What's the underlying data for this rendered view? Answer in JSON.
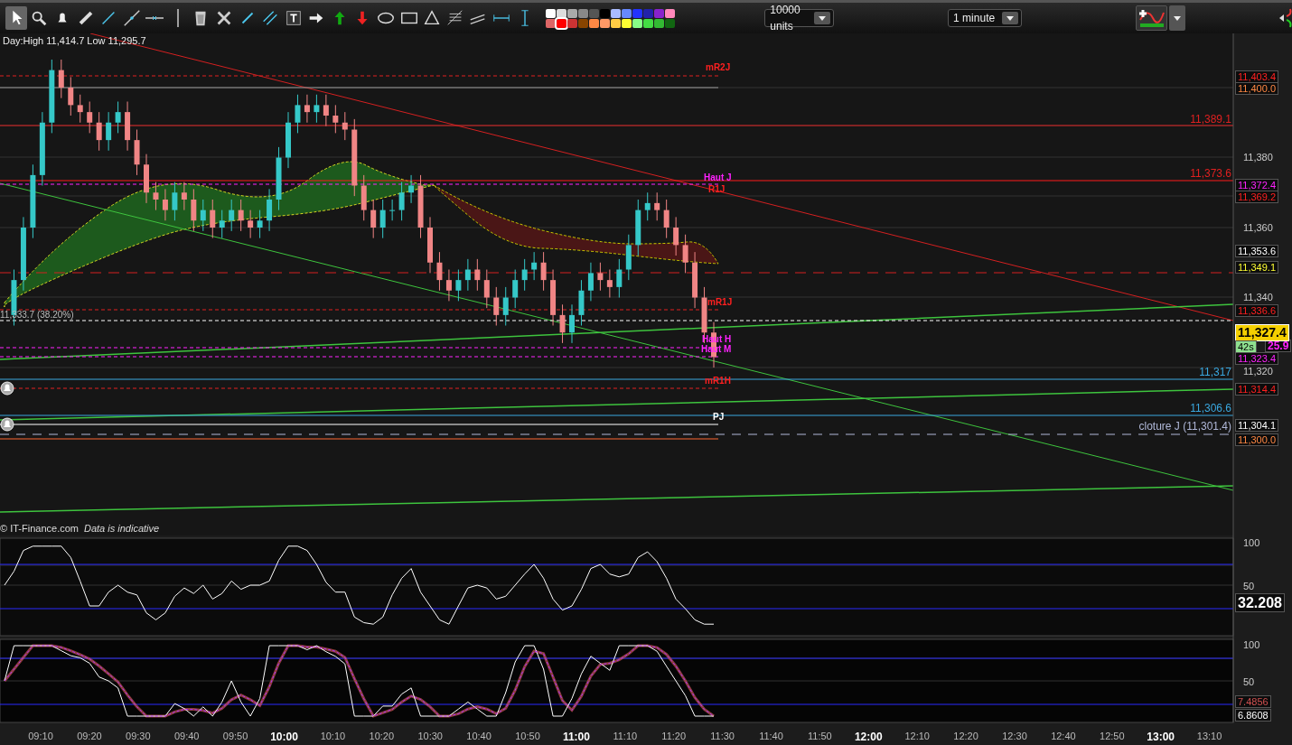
{
  "toolbar": {
    "tools": [
      {
        "selected": true
      },
      {
        "selected": false
      },
      {
        "selected": false
      },
      {
        "selected": false
      },
      {
        "selected": false
      },
      {
        "selected": false
      },
      {
        "selected": false
      },
      {
        "selected": false
      },
      {
        "selected": false
      },
      {
        "selected": false
      },
      {
        "selected": false
      },
      {
        "selected": false
      },
      {
        "selected": false
      },
      {
        "selected": false
      },
      {
        "selected": false
      },
      {
        "selected": false
      },
      {
        "selected": false
      },
      {
        "selected": false
      },
      {
        "selected": false
      },
      {
        "selected": false
      },
      {
        "selected": false
      },
      {
        "selected": false
      },
      {
        "selected": false
      }
    ],
    "swatches": [
      {
        "color": "#ffffff",
        "selected": false
      },
      {
        "color": "#dddddd",
        "selected": false
      },
      {
        "color": "#aaaaaa",
        "selected": false
      },
      {
        "color": "#888888",
        "selected": false
      },
      {
        "color": "#555555",
        "selected": false
      },
      {
        "color": "#000000",
        "selected": false
      },
      {
        "color": "#aabbff",
        "selected": false
      },
      {
        "color": "#6688ff",
        "selected": false
      },
      {
        "color": "#2233ff",
        "selected": false
      },
      {
        "color": "#2222aa",
        "selected": false
      },
      {
        "color": "#8822cc",
        "selected": false
      },
      {
        "color": "#ff88bb",
        "selected": false
      },
      {
        "color": "#dd6666",
        "selected": false
      },
      {
        "color": "#ff0000",
        "selected": true
      },
      {
        "color": "#cc3333",
        "selected": false
      },
      {
        "color": "#884400",
        "selected": false
      },
      {
        "color": "#ff8844",
        "selected": false
      },
      {
        "color": "#ff9966",
        "selected": false
      },
      {
        "color": "#ffcc44",
        "selected": false
      },
      {
        "color": "#ffff33",
        "selected": false
      },
      {
        "color": "#88ff88",
        "selected": false
      },
      {
        "color": "#44dd44",
        "selected": false
      },
      {
        "color": "#33bb33",
        "selected": false
      },
      {
        "color": "#116611",
        "selected": false
      }
    ],
    "quantity_dropdown": {
      "value": "10000 units"
    },
    "interval_dropdown": {
      "value": "1 minute"
    }
  },
  "chart": {
    "header": "Day:High 11,414.7 Low 11,295.7",
    "fib_label": "11,333.7 (38.20%)",
    "level_labels": [
      {
        "text": "mR2J",
        "color": "#ff2020"
      },
      {
        "text": "Haut J",
        "color": "#ff22ff"
      },
      {
        "text": "R1J",
        "color": "#ff2020"
      },
      {
        "text": "mR1J",
        "color": "#ff2020"
      },
      {
        "text": "Haut H",
        "color": "#ff22ff"
      },
      {
        "text": "Haut M",
        "color": "#ff22ff"
      },
      {
        "text": "mR1H",
        "color": "#ff2020"
      },
      {
        "text": "PJ",
        "color": "#ffffff"
      }
    ],
    "line_labels": [
      {
        "text": "11,389.1",
        "kind": "resistance"
      },
      {
        "text": "11,373.6",
        "kind": "resistance"
      },
      {
        "text": "11,317",
        "kind": "pivot"
      },
      {
        "text": "11,306.6",
        "kind": "pivot"
      },
      {
        "text": "cloture J (11,301.4)",
        "kind": "close"
      }
    ],
    "copyright": "© IT-Finance.com",
    "disclaimer": "Data is indicative",
    "price_axis": {
      "ticks": [
        "11,380",
        "11,360",
        "11,340",
        "11,320"
      ],
      "tags": [
        {
          "text": "11,403.4",
          "color": "#ff2020"
        },
        {
          "text": "11,400.0",
          "color": "#ff8844"
        },
        {
          "text": "11,372.4",
          "color": "#ff22ff"
        },
        {
          "text": "11,369.2",
          "color": "#ff2020"
        },
        {
          "text": "11,353.6",
          "color": "#ffffff"
        },
        {
          "text": "11,349.1",
          "color": "#ffff33"
        },
        {
          "text": "11,336.6",
          "color": "#ff2020"
        },
        {
          "text": "25.9",
          "color": "#ff22ff"
        },
        {
          "text": "11,323.4",
          "color": "#ff22ff"
        },
        {
          "text": "11,314.4",
          "color": "#ff2020"
        },
        {
          "text": "11,304.1",
          "color": "#ffffff"
        },
        {
          "text": "11,300.0",
          "color": "#ff8844"
        }
      ],
      "last_price": "11,327.4",
      "countdown": "42s"
    }
  },
  "rsi_panel": {
    "ticks": [
      "100",
      "50"
    ],
    "value": "32.208"
  },
  "stochastic_panel": {
    "ticks": [
      "100",
      "50"
    ],
    "values": [
      {
        "text": "7.4856",
        "color": "#d05050"
      },
      {
        "text": "6.8608",
        "color": "#ffffff"
      }
    ]
  },
  "time_axis": [
    {
      "label": "09:10",
      "major": false
    },
    {
      "label": "09:20",
      "major": false
    },
    {
      "label": "09:30",
      "major": false
    },
    {
      "label": "09:40",
      "major": false
    },
    {
      "label": "09:50",
      "major": false
    },
    {
      "label": "10:00",
      "major": true
    },
    {
      "label": "10:10",
      "major": false
    },
    {
      "label": "10:20",
      "major": false
    },
    {
      "label": "10:30",
      "major": false
    },
    {
      "label": "10:40",
      "major": false
    },
    {
      "label": "10:50",
      "major": false
    },
    {
      "label": "11:00",
      "major": true
    },
    {
      "label": "11:10",
      "major": false
    },
    {
      "label": "11:20",
      "major": false
    },
    {
      "label": "11:30",
      "major": false
    },
    {
      "label": "11:40",
      "major": false
    },
    {
      "label": "11:50",
      "major": false
    },
    {
      "label": "12:00",
      "major": true
    },
    {
      "label": "12:10",
      "major": false
    },
    {
      "label": "12:20",
      "major": false
    },
    {
      "label": "12:30",
      "major": false
    },
    {
      "label": "12:40",
      "major": false
    },
    {
      "label": "12:50",
      "major": false
    },
    {
      "label": "13:00",
      "major": true
    },
    {
      "label": "13:10",
      "major": false
    }
  ]
}
